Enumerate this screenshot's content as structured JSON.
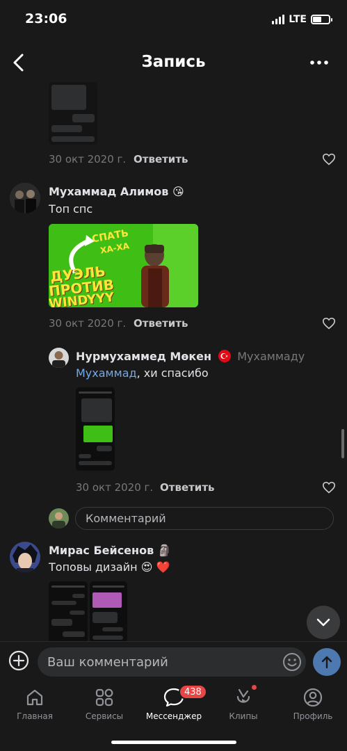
{
  "status": {
    "time": "23:06",
    "network": "LTE"
  },
  "header": {
    "title": "Запись"
  },
  "comments": [
    {
      "date": "30 окт 2020 г.",
      "reply": "Ответить"
    },
    {
      "author": "Мухаммад Алимов",
      "author_emoji": "😘",
      "text": "Топ спс",
      "date": "30 окт 2020 г.",
      "reply": "Ответить",
      "image_text": [
        "СПАТЬ",
        "ХА-ХА",
        "ДУЭЛЬ",
        "ПРОТИВ",
        "WINDYYY"
      ]
    },
    {
      "author": "Нурмухаммед Мөкен",
      "to": "Мухаммаду",
      "mention": "Мухаммад",
      "text": ", хи спасибо",
      "date": "30 окт 2020 г.",
      "reply": "Ответить"
    },
    {
      "author": "Мирас Бейсенов",
      "author_emoji": "🗿",
      "text": "Топовы дизайн",
      "text_emoji": "😍 ❤️"
    }
  ],
  "reply_box": {
    "placeholder": "Комментарий"
  },
  "composer": {
    "placeholder": "Ваш комментарий"
  },
  "tabs": [
    {
      "label": "Главная",
      "icon": "home-icon"
    },
    {
      "label": "Сервисы",
      "icon": "services-icon"
    },
    {
      "label": "Мессенджер",
      "icon": "messenger-icon",
      "active": true,
      "badge": "438"
    },
    {
      "label": "Клипы",
      "icon": "clips-icon"
    },
    {
      "label": "Профиль",
      "icon": "profile-icon"
    }
  ],
  "colors": {
    "background": "#19191a",
    "accent": "#71aaeb",
    "badge": "#e64646",
    "send": "#4d79b0"
  }
}
